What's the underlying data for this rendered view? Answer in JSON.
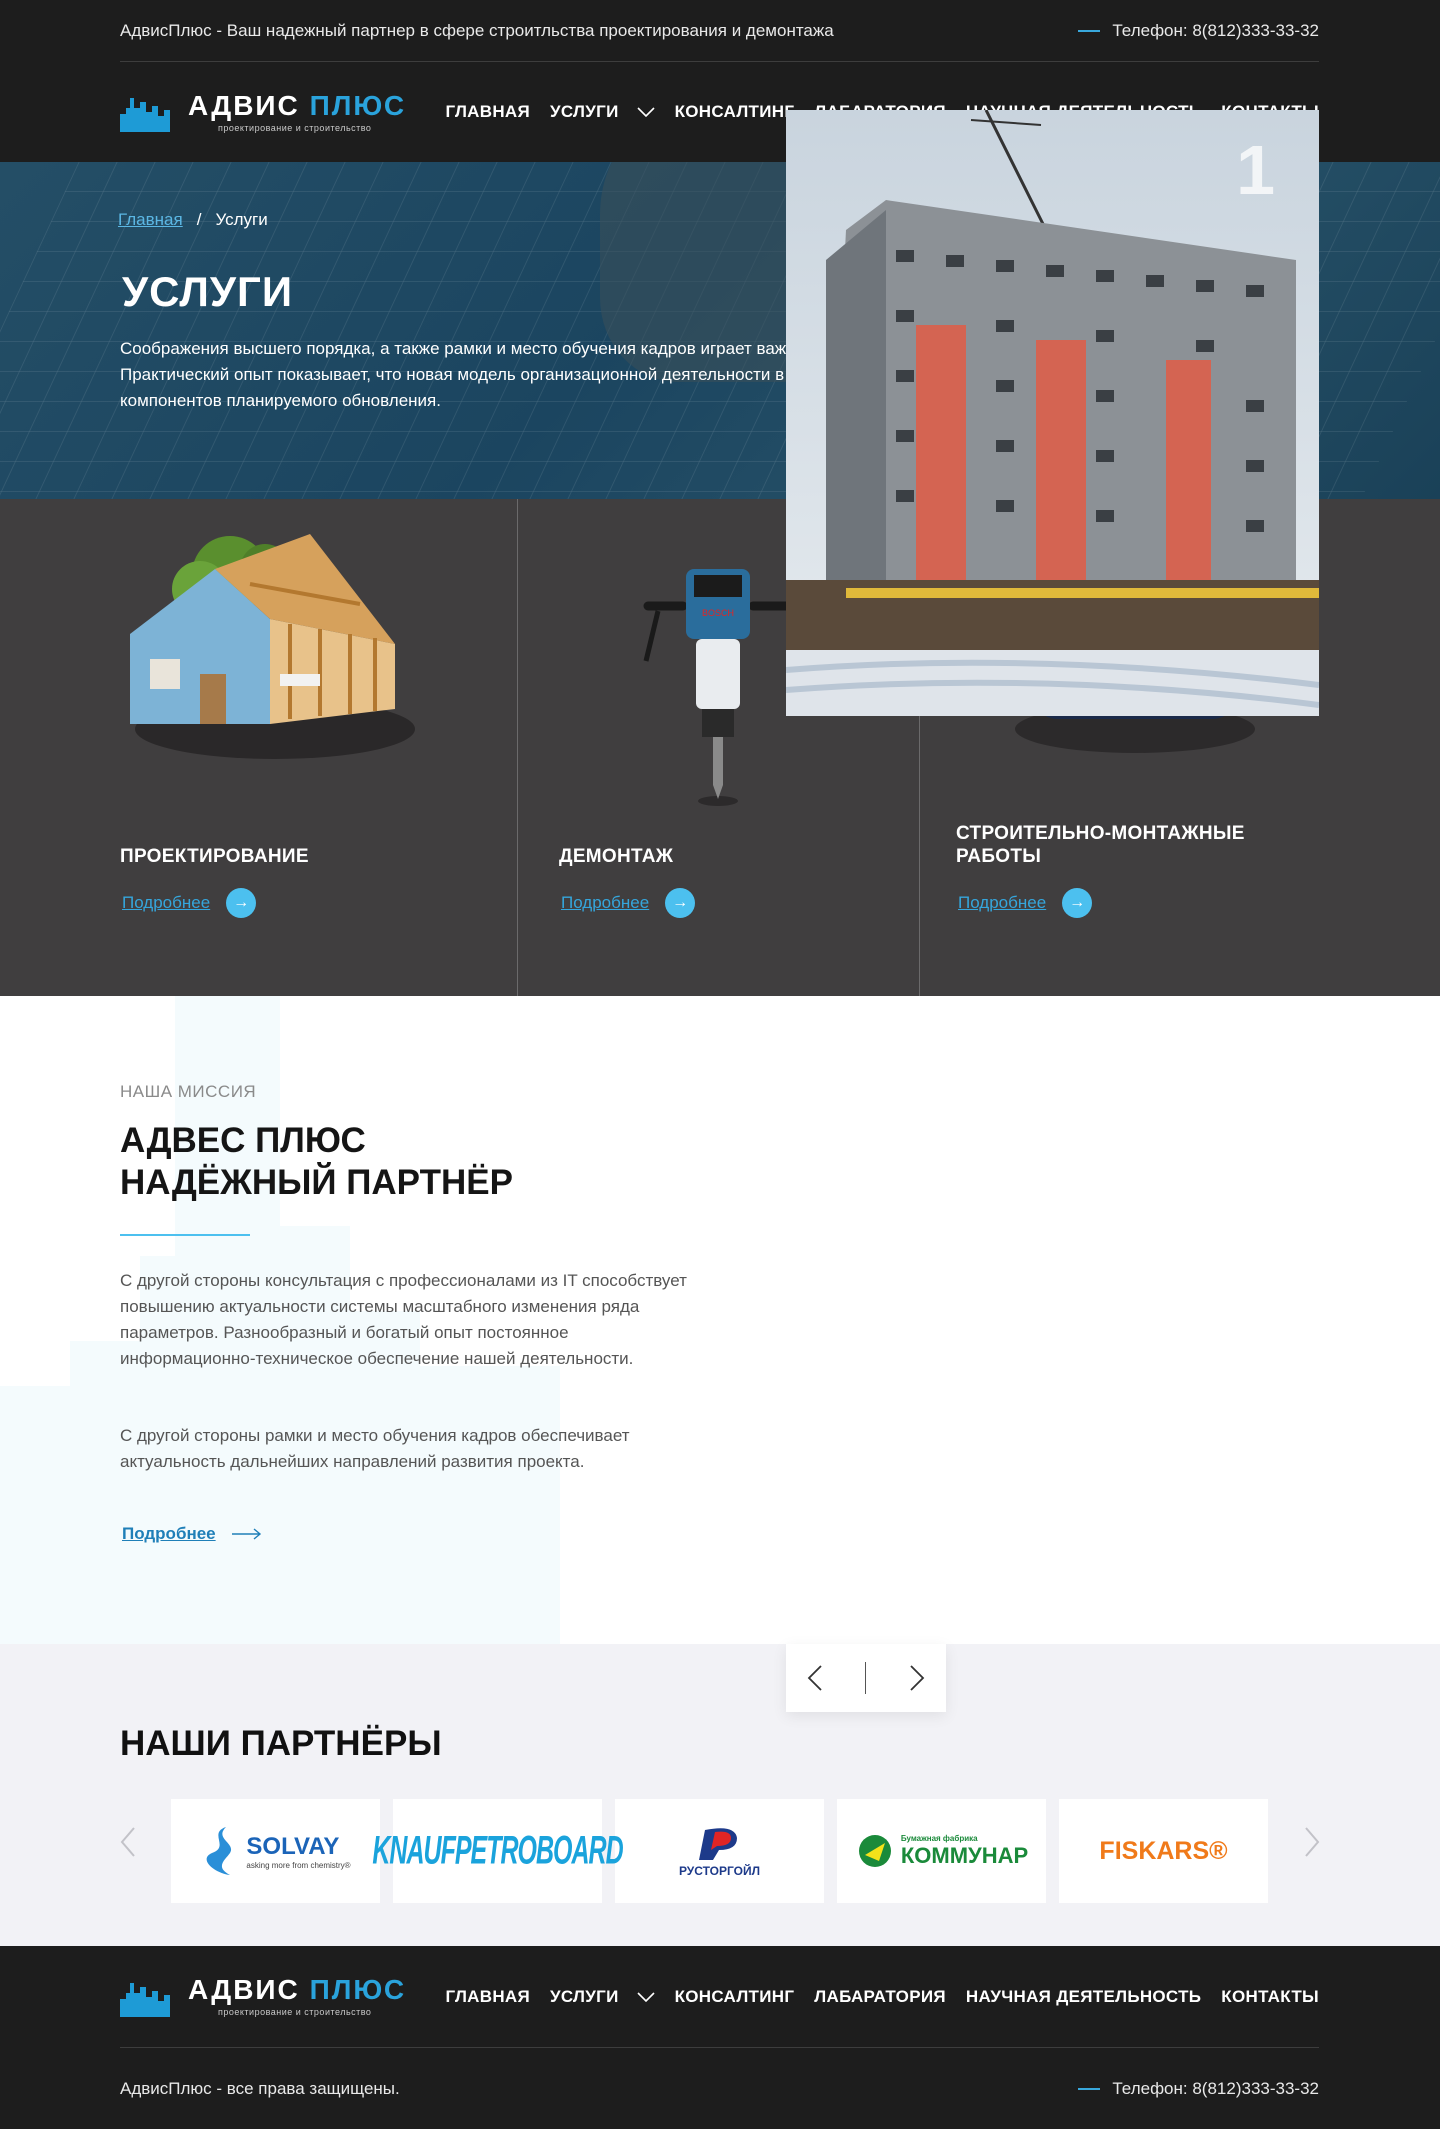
{
  "topbar": {
    "tagline": "АдвисПлюс - Ваш надежный партнер в сфере строитльства проектирования и демонтажа",
    "phone": "Телефон: 8(812)333-33-32"
  },
  "logo": {
    "name_a": "АДВИС",
    "name_b": "ПЛЮС",
    "sub": "проектирование и строительство"
  },
  "nav": {
    "items": [
      "ГЛАВНАЯ",
      "УСЛУГИ",
      "КОНСАЛТИНГ",
      "ЛАБАРАТОРИЯ",
      "НАУЧНАЯ ДЕЯТЕЛЬНОСТЬ",
      "КОНТАКТЫ"
    ]
  },
  "hero": {
    "breadcrumb_home": "Главная",
    "breadcrumb_sep": "/",
    "breadcrumb_current": "Услуги",
    "title": "УСЛУГИ",
    "text": "Соображения высшего порядка, а также рамки и место обучения кадров играет важную роль в формировании соответствующих условий активизации. Практический опыт показывает, что новая модель организационной деятельности в значительной степени обуславливает создание ключевых компонентов планируемого обновления."
  },
  "services": [
    {
      "title": "ПРОЕКТИРОВАНИЕ",
      "more": "Подробнее",
      "icon": "house-icon"
    },
    {
      "title": "ДЕМОНТАЖ",
      "more": "Подробнее",
      "icon": "jackhammer-icon"
    },
    {
      "title": "СТРОИТЕЛЬНО-МОНТАЖНЫЕ РАБОТЫ",
      "more": "Подробнее",
      "icon": "toolbag-icon"
    }
  ],
  "mission": {
    "kicker": "НАША МИССИЯ",
    "title_1": "АДВЕС ПЛЮС",
    "title_2": "НАДЁЖНЫЙ ПАРТНЁР",
    "p1": "С другой стороны консультация с профессионалами из IT способствует повышению актуальности системы масштабного изменения ряда параметров. Разнообразный и богатый опыт постоянное информационно-техническое обеспечение нашей деятельности.",
    "p2": "С другой стороны рамки и место обучения кадров обеспечивает актуальность дальнейших направлений развития проекта.",
    "more": "Подробнее",
    "slide_number": "1"
  },
  "partners": {
    "title": "НАШИ ПАРТНЁРЫ",
    "logos": [
      {
        "name": "SOLVAY",
        "sub": "asking more from chemistry®",
        "color": "#1b64b8"
      },
      {
        "name": "KNAUFPETROBOARD",
        "color": "#1aa3dc"
      },
      {
        "name": "РУСТОРГОЙЛ",
        "color": "#1d3a8a"
      },
      {
        "name": "КОММУНАР",
        "sub": "Бумажная фабрика",
        "color": "#1a8a3a"
      },
      {
        "name": "FISKARS®",
        "color": "#f07a1a"
      }
    ]
  },
  "footer": {
    "copyright": "АдвисПлюс - все права защищены.",
    "phone": "Телефон: 8(812)333-33-32"
  },
  "colors": {
    "accent": "#4cc0ef",
    "dark": "#1d1d1d",
    "services_bg": "#403e3f",
    "link": "#35a6dc"
  }
}
